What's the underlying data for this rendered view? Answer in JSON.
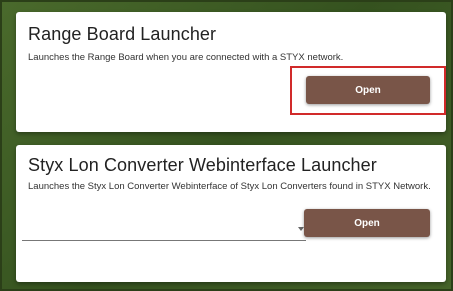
{
  "cards": [
    {
      "title": "Range Board Launcher",
      "description": "Launches the Range Board when you are connected with a STYX network.",
      "button_label": "Open"
    },
    {
      "title": "Styx Lon Converter Webinterface Launcher",
      "description": "Launches the Styx Lon Converter Webinterface of Styx Lon Converters found in STYX Network.",
      "select_value": "",
      "button_label": "Open"
    }
  ],
  "colors": {
    "background": "#3c5a24",
    "card": "#ffffff",
    "button": "#795548",
    "highlight": "#d12a2a"
  },
  "icons": {
    "dropdown": "chevron-down-icon"
  }
}
